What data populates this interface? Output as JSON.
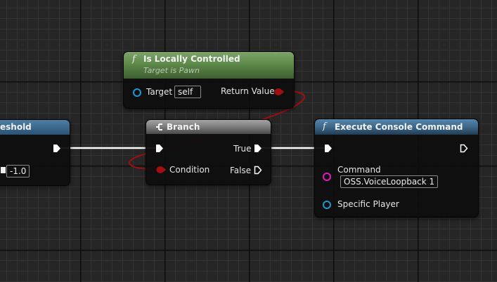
{
  "locally_controlled_node": {
    "title": "Is Locally Controlled",
    "subtitle": "Target is Pawn",
    "function_glyph": "f",
    "target_label": "Target",
    "target_value": "self",
    "return_label": "Return Value"
  },
  "threshold_node": {
    "title_fragment": "eshold",
    "value": "-1.0"
  },
  "branch_node": {
    "title": "Branch",
    "condition_label": "Condition",
    "true_label": "True",
    "false_label": "False"
  },
  "execute_node": {
    "title": "Execute Console Command",
    "function_glyph": "f",
    "command_label": "Command",
    "command_value": "OSS.VoiceLoopback 1",
    "player_label": "Specific Player"
  },
  "colors": {
    "pure_header": "#5e8a4a",
    "function_header": "#3f6b8e",
    "branch_header": "#8c8c8c",
    "bool_pin": "#a10f0f",
    "object_pin": "#1c97d6",
    "string_pin": "#e01bc4",
    "exec_pin": "#ffffff"
  }
}
